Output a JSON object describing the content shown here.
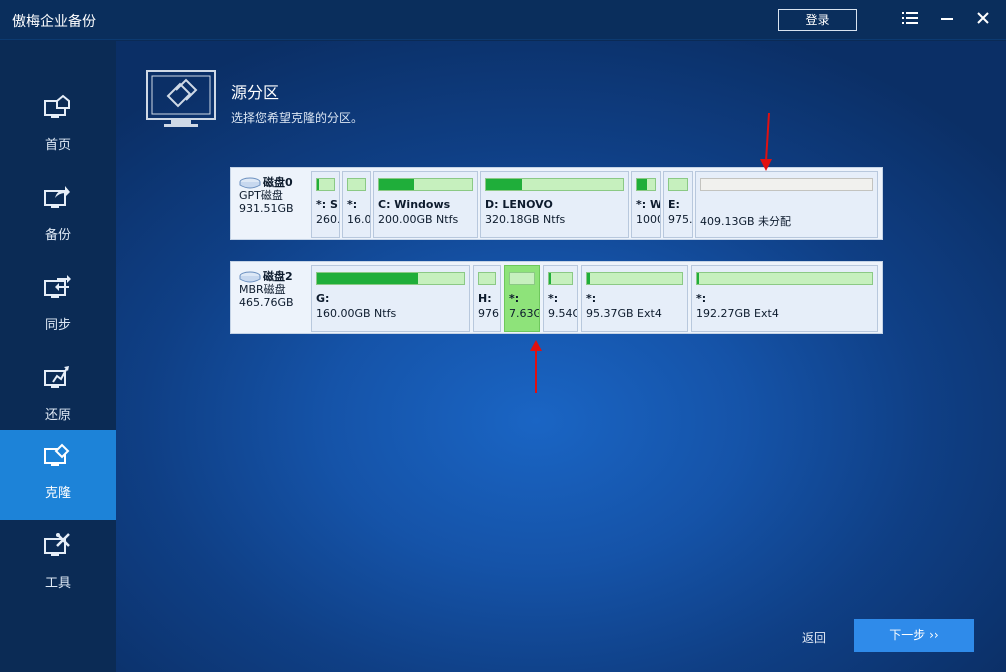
{
  "app": {
    "title": "傲梅企业备份"
  },
  "titlebar": {
    "login_label": "登录",
    "menu_icon": "menu-icon",
    "minimize_icon": "minimize-icon",
    "close_icon": "close-icon"
  },
  "sidebar": {
    "items": [
      {
        "label": "首页",
        "icon": "home-icon",
        "active": false
      },
      {
        "label": "备份",
        "icon": "backup-icon",
        "active": false
      },
      {
        "label": "同步",
        "icon": "sync-icon",
        "active": false
      },
      {
        "label": "还原",
        "icon": "restore-icon",
        "active": false
      },
      {
        "label": "克隆",
        "icon": "clone-icon",
        "active": true
      },
      {
        "label": "工具",
        "icon": "tools-icon",
        "active": false
      }
    ]
  },
  "main": {
    "title": "源分区",
    "subtitle": "选择您希望克隆的分区。"
  },
  "disks": [
    {
      "name": "磁盘0",
      "type": "GPT磁盘",
      "size": "931.51GB",
      "partitions": [
        {
          "label": "*: S",
          "size": "260.",
          "used": 0.12
        },
        {
          "label": "*:",
          "size": "16.0",
          "used": 0.0
        },
        {
          "label": "C: Windows",
          "size": "200.00GB Ntfs",
          "used": 0.38
        },
        {
          "label": "D: LENOVO",
          "size": "320.18GB Ntfs",
          "used": 0.26
        },
        {
          "label": "*: W",
          "size": "1000",
          "used": 0.55
        },
        {
          "label": "E:",
          "size": "975.",
          "used": 0.0
        },
        {
          "label": "",
          "size": "409.13GB 未分配",
          "used": 0.0,
          "unallocated": true
        }
      ]
    },
    {
      "name": "磁盘2",
      "type": "MBR磁盘",
      "size": "465.76GB",
      "partitions": [
        {
          "label": "G:",
          "size": "160.00GB Ntfs",
          "used": 0.69
        },
        {
          "label": "H:",
          "size": "976.",
          "used": 0.0
        },
        {
          "label": "*:",
          "size": "7.63G",
          "used": 0.0,
          "selected": true
        },
        {
          "label": "*:",
          "size": "9.54G",
          "used": 0.08
        },
        {
          "label": "*:",
          "size": "95.37GB Ext4",
          "used": 0.03
        },
        {
          "label": "*:",
          "size": "192.27GB Ext4",
          "used": 0.01
        }
      ]
    }
  ],
  "footer": {
    "back_label": "返回",
    "next_label": "下一步 ››"
  },
  "colors": {
    "accent": "#2f8bea",
    "sidebar_active": "#1d83d8",
    "used_fill": "#1fae3a",
    "selected_partition": "#8ee37a",
    "annotation_arrow": "#e01010"
  }
}
